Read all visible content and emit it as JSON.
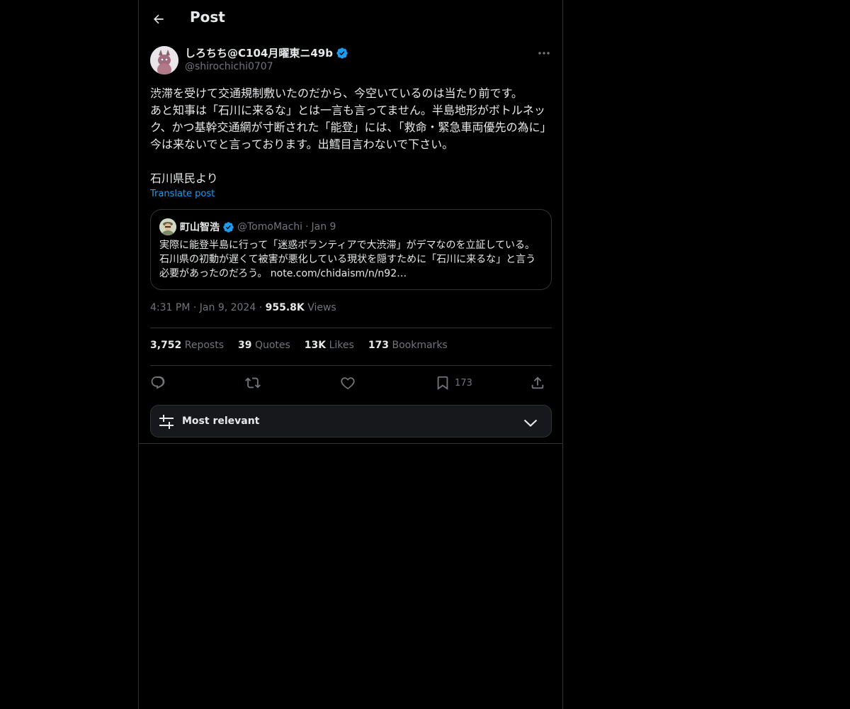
{
  "header": {
    "title": "Post"
  },
  "author": {
    "name": "しろちち@C104月曜東ニ49b",
    "handle": "@shirochichi0707"
  },
  "post": {
    "text": "渋滞を受けて交通規制敷いたのだから、今空いているのは当たり前です。\nあと知事は「石川に来るな」とは一言も言ってません。半島地形がボトルネック、かつ基幹交通網が寸断された「能登」には、「救命・緊急車両優先の為に」今は来ないでと言っております。出鱈目言わないで下さい。\n\n石川県民より",
    "translate_label": "Translate post",
    "time": "4:31 PM",
    "date": "Jan 9, 2024",
    "views_count": "955.8K",
    "views_label": "Views",
    "separator": "·"
  },
  "quote": {
    "name": "町山智浩",
    "handle": "@TomoMachi",
    "separator": "·",
    "date": "Jan 9",
    "text": "実際に能登半島に行って「迷惑ボランティアで大渋滞」がデマなのを立証している。石川県の初動が遅くて被害が悪化している現状を隠すために「石川に来るな」と言う必要があったのだろう。 note.com/chidaism/n/n92…"
  },
  "stats": [
    {
      "count": "3,752",
      "label": "Reposts"
    },
    {
      "count": "39",
      "label": "Quotes"
    },
    {
      "count": "13K",
      "label": "Likes"
    },
    {
      "count": "173",
      "label": "Bookmarks"
    }
  ],
  "actions": {
    "reply_icon": "reply-icon",
    "repost_icon": "repost-icon",
    "like_icon": "heart-icon",
    "bookmark_icon": "bookmark-icon",
    "bookmark_count": "173",
    "share_icon": "share-icon"
  },
  "sort": {
    "label": "Most relevant"
  },
  "colors": {
    "background": "#000000",
    "text": "#e7e9ea",
    "muted": "#71767b",
    "accent": "#1d9bf0",
    "border": "#2f3336"
  }
}
